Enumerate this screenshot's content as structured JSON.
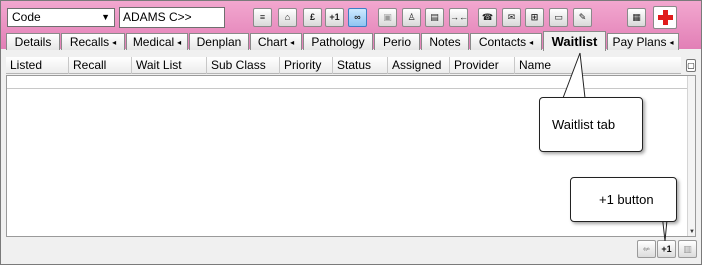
{
  "toolbar": {
    "code_select_value": "Code",
    "patient_field_value": "ADAMS C>>",
    "buttons": [
      "≡",
      "⌂",
      "£",
      "+1",
      "∞",
      "▣",
      "♙",
      "▤",
      "→←",
      "☎",
      "✉",
      "⊞",
      "▭",
      "✎",
      "▦"
    ]
  },
  "tabs": [
    {
      "label": "Details"
    },
    {
      "label": "Recalls"
    },
    {
      "label": "Medical"
    },
    {
      "label": "Denplan"
    },
    {
      "label": "Chart"
    },
    {
      "label": "Pathology"
    },
    {
      "label": "Perio"
    },
    {
      "label": "Notes"
    },
    {
      "label": "Contacts"
    },
    {
      "label": "Waitlist",
      "selected": true
    },
    {
      "label": "Pay Plans"
    }
  ],
  "columns": [
    "Listed",
    "Recall",
    "Wait List",
    "Sub Class",
    "Priority",
    "Status",
    "Assigned",
    "Provider",
    "Name"
  ],
  "bottom_buttons": {
    "left": "⇍",
    "plus_one": "+1",
    "delete": "▥"
  },
  "callouts": {
    "waitlist_tab": "Waitlist tab",
    "plus_one_button": "+1 button"
  },
  "colors": {
    "toolbar_pink": "#e98bc0",
    "medical_cross": "#e01b1b",
    "active_button": "#8fc4f2"
  }
}
